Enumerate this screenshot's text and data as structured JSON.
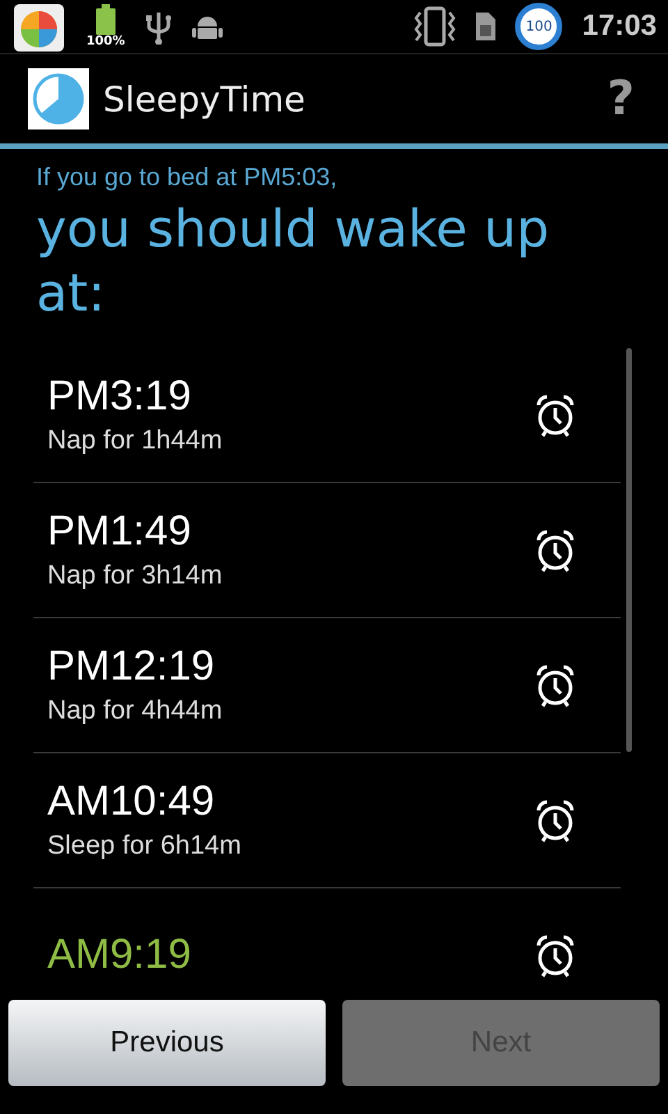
{
  "status_bar": {
    "battery_text": "100%",
    "badge": "100",
    "time": "17:03"
  },
  "app_bar": {
    "title": "SleepyTime",
    "help": "?"
  },
  "intro": {
    "line": "If you go to bed at PM5:03,",
    "heading": "you should wake up at:"
  },
  "times": [
    {
      "time": "PM3:19",
      "note": "Nap for 1h44m",
      "highlight": false
    },
    {
      "time": "PM1:49",
      "note": "Nap for 3h14m",
      "highlight": false
    },
    {
      "time": "PM12:19",
      "note": "Nap for 4h44m",
      "highlight": false
    },
    {
      "time": "AM10:49",
      "note": "Sleep for 6h14m",
      "highlight": false
    },
    {
      "time": "AM9:19",
      "highlight": true
    }
  ],
  "buttons": [
    {
      "label": "Previous",
      "disabled": false
    },
    {
      "label": "Next",
      "disabled": true
    }
  ]
}
